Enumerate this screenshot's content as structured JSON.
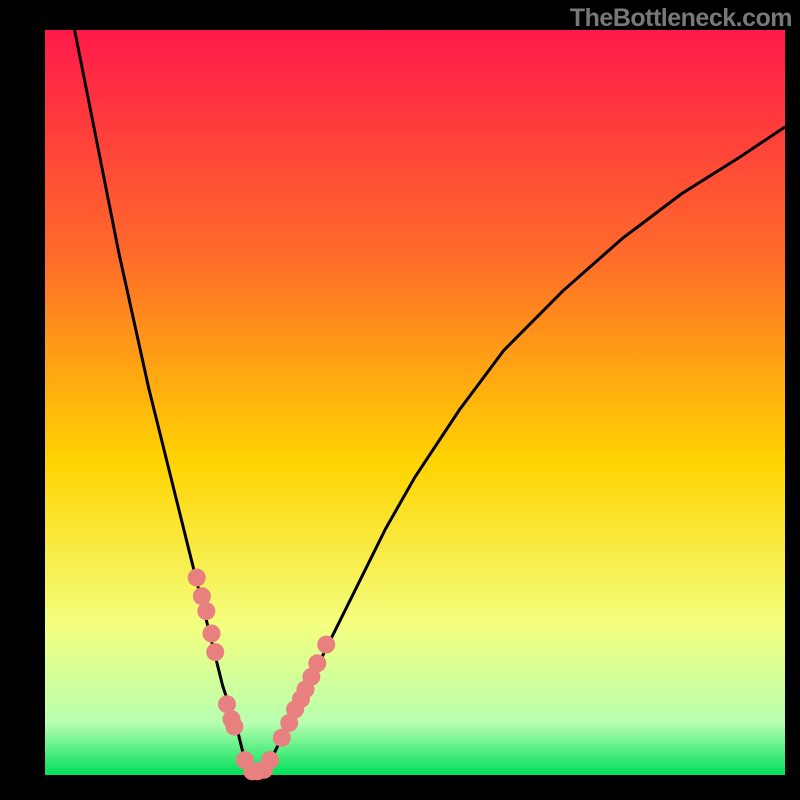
{
  "watermark": "TheBottleneck.com",
  "chart_data": {
    "type": "line",
    "title": "",
    "xlabel": "",
    "ylabel": "",
    "xlim": [
      0,
      100
    ],
    "ylim": [
      0,
      100
    ],
    "series": [
      {
        "name": "bottleneck-curve",
        "x": [
          4,
          6,
          8,
          10,
          12,
          14,
          16,
          18,
          20,
          22,
          24,
          26,
          27,
          28,
          29,
          30,
          34,
          38,
          42,
          46,
          50,
          56,
          62,
          70,
          78,
          86,
          94,
          100
        ],
        "y": [
          100,
          90,
          80,
          70,
          61,
          52,
          44,
          36,
          28,
          20,
          12,
          6,
          2,
          0,
          0,
          1,
          9,
          17,
          25,
          33,
          40,
          49,
          57,
          65,
          72,
          78,
          83,
          87
        ]
      }
    ],
    "markers": {
      "name": "highlight-points",
      "x": [
        20.5,
        21.2,
        21.8,
        22.5,
        23.0,
        24.6,
        25.2,
        25.6,
        27.0,
        28.0,
        28.7,
        29.6,
        30.4,
        32.0,
        33.0,
        33.8,
        34.6,
        35.2,
        36.0,
        36.8,
        38.0
      ],
      "y": [
        26.5,
        24.0,
        22.0,
        19.0,
        16.5,
        9.5,
        7.5,
        6.5,
        2.0,
        0.5,
        0.5,
        0.7,
        2.0,
        5.0,
        7.0,
        8.8,
        10.2,
        11.5,
        13.2,
        15.0,
        17.5
      ]
    },
    "gradient": {
      "top": "#ff1a4a",
      "upper_mid": "#ff6a2a",
      "mid": "#ffd400",
      "lower_mid": "#f3ff80",
      "near_bottom": "#b8ffb0",
      "bottom": "#00e05a"
    },
    "marker_color": "#e98080",
    "curve_color": "#000000"
  }
}
